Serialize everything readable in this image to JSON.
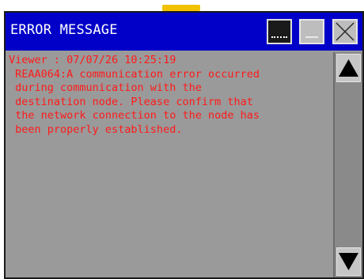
{
  "window": {
    "title": "ERROR MESSAGE"
  },
  "message": {
    "lines": [
      "Viewer : 07/07/26 10:25:19",
      " REAA064:A communication error occurred",
      " during communication with the",
      " destination node. Please confirm that",
      " the network connection to the node has",
      " been properly established."
    ]
  },
  "icons": {
    "title_button_1": "dotted-underline-icon",
    "title_button_2": "minimize-icon",
    "close": "close-x-icon",
    "scroll_up": "triangle-up-icon",
    "scroll_down": "triangle-down-icon"
  },
  "colors": {
    "titlebar": "#0000c8",
    "message_text": "#ff1a1a",
    "window_bg": "#9a9a9a"
  }
}
